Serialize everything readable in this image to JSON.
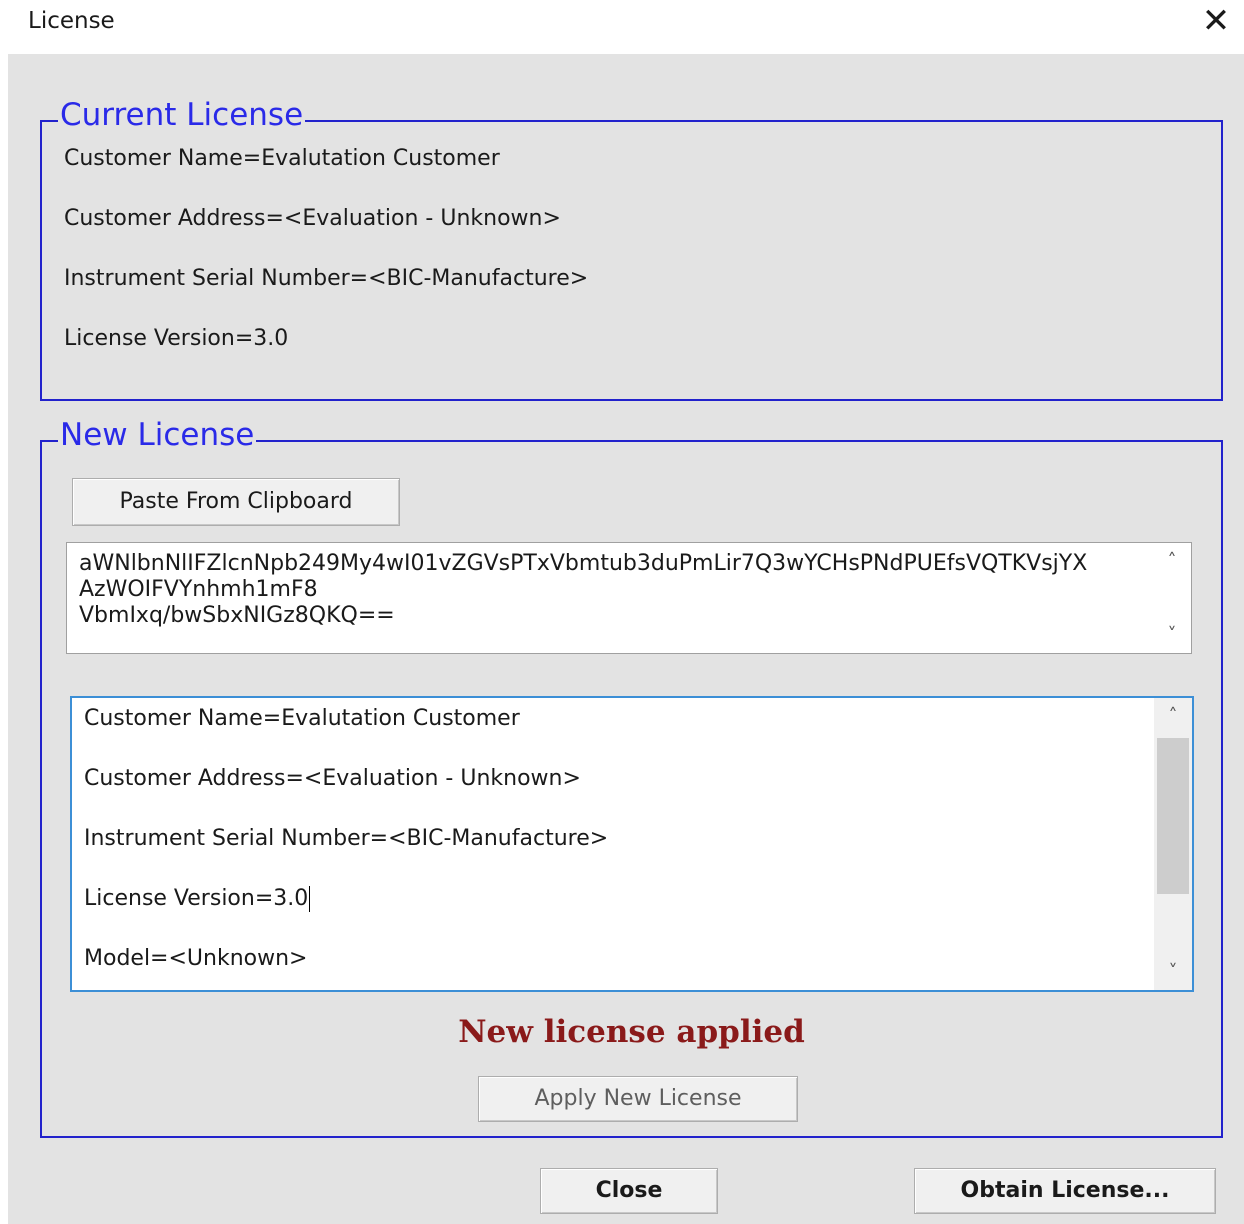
{
  "window": {
    "title": "License",
    "close_glyph": "✕"
  },
  "current_license": {
    "legend": "Current License",
    "lines": [
      "Customer Name=Evalutation Customer",
      "Customer Address=<Evaluation - Unknown>",
      "Instrument Serial Number=<BIC-Manufacture>",
      "License Version=3.0"
    ]
  },
  "new_license": {
    "legend": "New License",
    "paste_button": "Paste From Clipboard",
    "key_text": "aWNlbnNlIFZlcnNpb249My4wI01vZGVsPTxVbmtub3duPmLir7Q3wYCHsPNdPUEfsVQTKVsjYX\nAzWOIFVYnhmh1mF8\nVbmIxq/bwSbxNIGz8QKQ==",
    "decoded_lines": [
      "Customer Name=Evalutation Customer",
      "Customer Address=<Evaluation - Unknown>",
      "Instrument Serial Number=<BIC-Manufacture>",
      "License Version=3.0",
      "Model=<Unknown>"
    ],
    "status": "New license applied",
    "apply_button": "Apply New License"
  },
  "footer": {
    "close_button": "Close",
    "obtain_button": "Obtain License..."
  },
  "icons": {
    "scroll_up": "˄",
    "scroll_down": "˅"
  },
  "colors": {
    "group_border": "#2222cc",
    "legend_text": "#2a2ae8",
    "status_text": "#8a1a1a",
    "focus_border": "#3c8fd6"
  }
}
